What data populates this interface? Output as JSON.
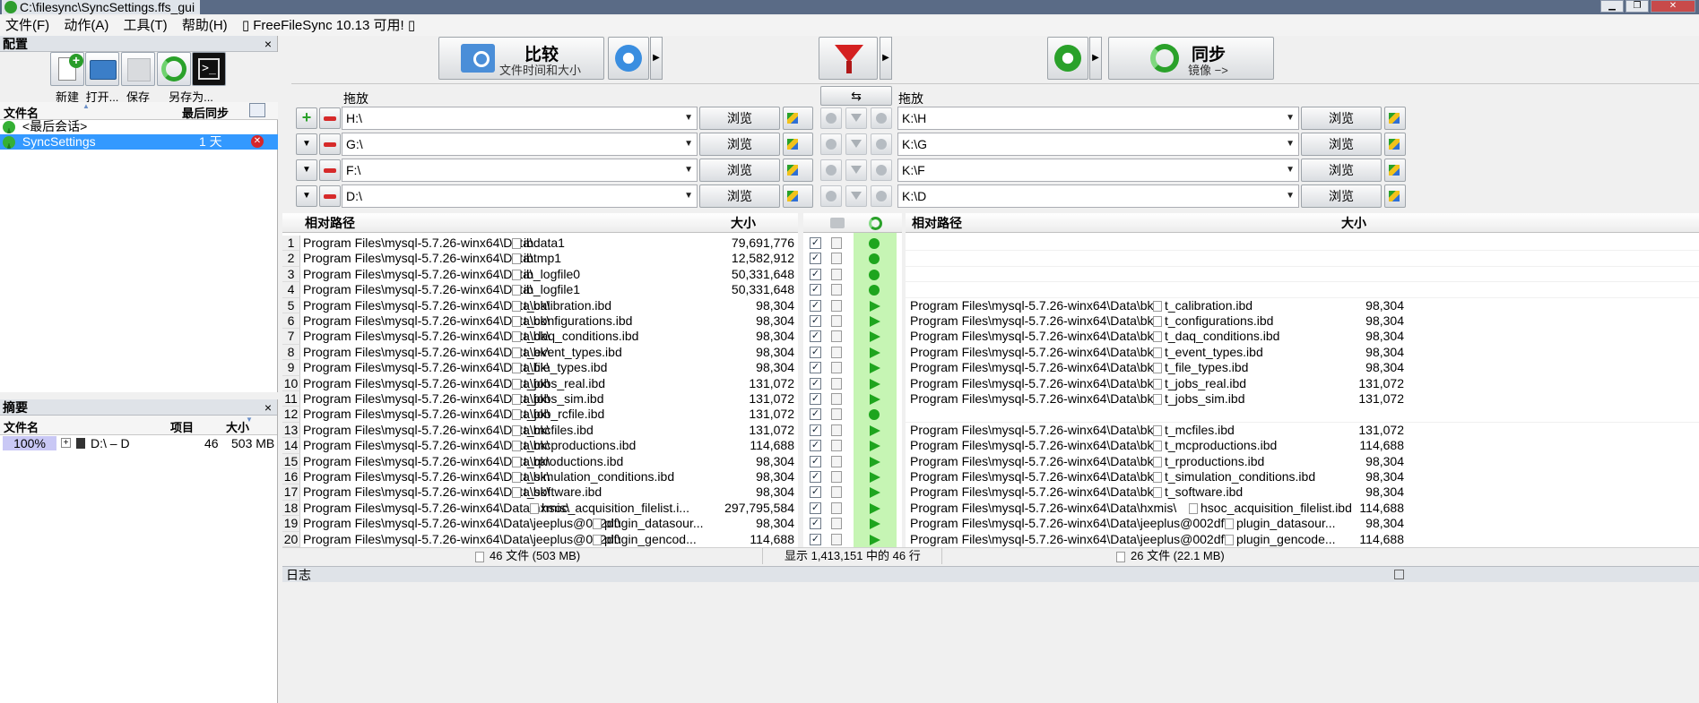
{
  "window": {
    "title": "C:\\filesync\\SyncSettings.ffs_gui",
    "min": "▁",
    "max": "❐",
    "close": "✕"
  },
  "menu": [
    "文件(F)",
    "动作(A)",
    "工具(T)",
    "帮助(H)",
    "▯ FreeFileSync 10.13 可用! ▯"
  ],
  "config": {
    "title": "配置",
    "close": "×",
    "buttons": [
      {
        "label": "新建",
        "icon": "new-config-icon"
      },
      {
        "label": "打开...",
        "icon": "open-config-icon"
      },
      {
        "label": "保存",
        "icon": "save-icon"
      },
      {
        "label": "另存为...",
        "icon": "save-as-icon"
      },
      {
        "label": "",
        "icon": "save-as-batch-icon"
      }
    ],
    "col_name": "文件名",
    "col_last_sync": "最后同步",
    "items": [
      {
        "name": "<最后会话>",
        "last_sync": ""
      },
      {
        "name": "SyncSettings",
        "last_sync": "1 天"
      }
    ]
  },
  "summary": {
    "title": "摘要",
    "close": "×",
    "col_name": "文件名",
    "col_items": "项目",
    "col_size": "大小",
    "row": {
      "percent": "100%",
      "name": "D:\\ – D",
      "items": "46",
      "size": "503 MB"
    }
  },
  "toolbar": {
    "compare_title": "比较",
    "compare_sub": "文件时间和大小",
    "sync_title": "同步",
    "sync_sub": "镜像 −>",
    "swap": "⇆",
    "drag_left": "拖放",
    "drag_right": "拖放"
  },
  "folder_pairs": [
    {
      "left": "H:\\",
      "right": "K:\\H"
    },
    {
      "left": "G:\\",
      "right": "K:\\G"
    },
    {
      "left": "F:\\",
      "right": "K:\\F"
    },
    {
      "left": "D:\\",
      "right": "K:\\D"
    }
  ],
  "browse_label": "浏览",
  "grid": {
    "left_header_path": "相对路径",
    "left_header_size": "大小",
    "right_header_path": "相对路径",
    "right_header_size": "大小",
    "rows": [
      {
        "n": "1",
        "ldir": "Program Files\\mysql-5.7.26-winx64\\Data\\",
        "lfile": "ibdata1",
        "lsize": "79,691,776",
        "rdir": "",
        "rfile": "",
        "rsize": "",
        "op": "create"
      },
      {
        "n": "2",
        "ldir": "Program Files\\mysql-5.7.26-winx64\\Data\\",
        "lfile": "ibtmp1",
        "lsize": "12,582,912",
        "rdir": "",
        "rfile": "",
        "rsize": "",
        "op": "create"
      },
      {
        "n": "3",
        "ldir": "Program Files\\mysql-5.7.26-winx64\\Data\\",
        "lfile": "ib_logfile0",
        "lsize": "50,331,648",
        "rdir": "",
        "rfile": "",
        "rsize": "",
        "op": "create"
      },
      {
        "n": "4",
        "ldir": "Program Files\\mysql-5.7.26-winx64\\Data\\",
        "lfile": "ib_logfile1",
        "lsize": "50,331,648",
        "rdir": "",
        "rfile": "",
        "rsize": "",
        "op": "create"
      },
      {
        "n": "5",
        "ldir": "Program Files\\mysql-5.7.26-winx64\\Data\\bk\\",
        "lfile": "t_calibration.ibd",
        "lsize": "98,304",
        "rdir": "Program Files\\mysql-5.7.26-winx64\\Data\\bk\\",
        "rfile": "t_calibration.ibd",
        "rsize": "98,304",
        "op": "update"
      },
      {
        "n": "6",
        "ldir": "Program Files\\mysql-5.7.26-winx64\\Data\\bk\\",
        "lfile": "t_configurations.ibd",
        "lsize": "98,304",
        "rdir": "Program Files\\mysql-5.7.26-winx64\\Data\\bk\\",
        "rfile": "t_configurations.ibd",
        "rsize": "98,304",
        "op": "update"
      },
      {
        "n": "7",
        "ldir": "Program Files\\mysql-5.7.26-winx64\\Data\\bk\\",
        "lfile": "t_daq_conditions.ibd",
        "lsize": "98,304",
        "rdir": "Program Files\\mysql-5.7.26-winx64\\Data\\bk\\",
        "rfile": "t_daq_conditions.ibd",
        "rsize": "98,304",
        "op": "update"
      },
      {
        "n": "8",
        "ldir": "Program Files\\mysql-5.7.26-winx64\\Data\\bk\\",
        "lfile": "t_event_types.ibd",
        "lsize": "98,304",
        "rdir": "Program Files\\mysql-5.7.26-winx64\\Data\\bk\\",
        "rfile": "t_event_types.ibd",
        "rsize": "98,304",
        "op": "update"
      },
      {
        "n": "9",
        "ldir": "Program Files\\mysql-5.7.26-winx64\\Data\\bk\\",
        "lfile": "t_file_types.ibd",
        "lsize": "98,304",
        "rdir": "Program Files\\mysql-5.7.26-winx64\\Data\\bk\\",
        "rfile": "t_file_types.ibd",
        "rsize": "98,304",
        "op": "update"
      },
      {
        "n": "10",
        "ldir": "Program Files\\mysql-5.7.26-winx64\\Data\\bk\\",
        "lfile": "t_jobs_real.ibd",
        "lsize": "131,072",
        "rdir": "Program Files\\mysql-5.7.26-winx64\\Data\\bk\\",
        "rfile": "t_jobs_real.ibd",
        "rsize": "131,072",
        "op": "update"
      },
      {
        "n": "11",
        "ldir": "Program Files\\mysql-5.7.26-winx64\\Data\\bk\\",
        "lfile": "t_jobs_sim.ibd",
        "lsize": "131,072",
        "rdir": "Program Files\\mysql-5.7.26-winx64\\Data\\bk\\",
        "rfile": "t_jobs_sim.ibd",
        "rsize": "131,072",
        "op": "update"
      },
      {
        "n": "12",
        "ldir": "Program Files\\mysql-5.7.26-winx64\\Data\\bk\\",
        "lfile": "t_job_rcfile.ibd",
        "lsize": "131,072",
        "rdir": "",
        "rfile": "",
        "rsize": "",
        "op": "create"
      },
      {
        "n": "13",
        "ldir": "Program Files\\mysql-5.7.26-winx64\\Data\\bk\\",
        "lfile": "t_mcfiles.ibd",
        "lsize": "131,072",
        "rdir": "Program Files\\mysql-5.7.26-winx64\\Data\\bk\\",
        "rfile": "t_mcfiles.ibd",
        "rsize": "131,072",
        "op": "update"
      },
      {
        "n": "14",
        "ldir": "Program Files\\mysql-5.7.26-winx64\\Data\\bk\\",
        "lfile": "t_mcproductions.ibd",
        "lsize": "114,688",
        "rdir": "Program Files\\mysql-5.7.26-winx64\\Data\\bk\\",
        "rfile": "t_mcproductions.ibd",
        "rsize": "114,688",
        "op": "update"
      },
      {
        "n": "15",
        "ldir": "Program Files\\mysql-5.7.26-winx64\\Data\\bk\\",
        "lfile": "t_rproductions.ibd",
        "lsize": "98,304",
        "rdir": "Program Files\\mysql-5.7.26-winx64\\Data\\bk\\",
        "rfile": "t_rproductions.ibd",
        "rsize": "98,304",
        "op": "update"
      },
      {
        "n": "16",
        "ldir": "Program Files\\mysql-5.7.26-winx64\\Data\\bk\\",
        "lfile": "t_simulation_conditions.ibd",
        "lsize": "98,304",
        "rdir": "Program Files\\mysql-5.7.26-winx64\\Data\\bk\\",
        "rfile": "t_simulation_conditions.ibd",
        "rsize": "98,304",
        "op": "update"
      },
      {
        "n": "17",
        "ldir": "Program Files\\mysql-5.7.26-winx64\\Data\\bk\\",
        "lfile": "t_software.ibd",
        "lsize": "98,304",
        "rdir": "Program Files\\mysql-5.7.26-winx64\\Data\\bk\\",
        "rfile": "t_software.ibd",
        "rsize": "98,304",
        "op": "update"
      },
      {
        "n": "18",
        "ldir": "Program Files\\mysql-5.7.26-winx64\\Data\\hxmis\\",
        "lfile": "hsoc_acquisition_filelist.i...",
        "lsize": "297,795,584",
        "rdir": "Program Files\\mysql-5.7.26-winx64\\Data\\hxmis\\",
        "rfile": "hsoc_acquisition_filelist.ibd",
        "rsize": "114,688",
        "op": "update"
      },
      {
        "n": "19",
        "ldir": "Program Files\\mysql-5.7.26-winx64\\Data\\jeeplus@002df\\",
        "lfile": "plugin_datasour...",
        "lsize": "98,304",
        "rdir": "Program Files\\mysql-5.7.26-winx64\\Data\\jeeplus@002df\\",
        "rfile": "plugin_datasour...",
        "rsize": "98,304",
        "op": "update"
      },
      {
        "n": "20",
        "ldir": "Program Files\\mysql-5.7.26-winx64\\Data\\jeeplus@002df\\",
        "lfile": "plugin_gencod...",
        "lsize": "114,688",
        "rdir": "Program Files\\mysql-5.7.26-winx64\\Data\\jeeplus@002df\\",
        "rfile": "plugin_gencode...",
        "rsize": "114,688",
        "op": "update"
      }
    ]
  },
  "status": {
    "left": "46 文件 (503 MB)",
    "middle": "显示 1,413,151 中的 46 行",
    "right": "26 文件 (22.1 MB)"
  },
  "log": {
    "title": "日志"
  },
  "colors": {
    "selection": "#3399ff",
    "middle_green": "#c6f5b4",
    "arrow_green": "#1ea51e",
    "titlebar": "#5a6b86"
  }
}
